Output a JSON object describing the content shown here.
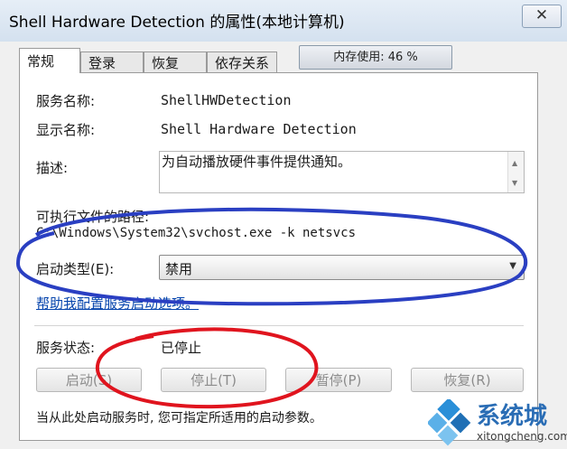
{
  "window": {
    "title": "Shell Hardware Detection 的属性(本地计算机)",
    "close_glyph": "✕"
  },
  "tabs": [
    {
      "label": "常规",
      "active": true
    },
    {
      "label": "登录",
      "active": false
    },
    {
      "label": "恢复",
      "active": false
    },
    {
      "label": "依存关系",
      "active": false
    }
  ],
  "memory": {
    "label": "内存使用: 46 %",
    "value": 46
  },
  "general": {
    "service_name_label": "服务名称:",
    "service_name_value": "ShellHWDetection",
    "display_name_label": "显示名称:",
    "display_name_value": "Shell Hardware Detection",
    "description_label": "描述:",
    "description_value": "为自动播放硬件事件提供通知。",
    "exe_path_label": "可执行文件的路径:",
    "exe_path_value": "C:\\Windows\\System32\\svchost.exe -k netsvcs",
    "startup_type_label": "启动类型(E):",
    "startup_type_value": "禁用",
    "help_link": "帮助我配置服务启动选项。",
    "status_label": "服务状态:",
    "status_value": "已停止",
    "buttons": {
      "start": "启动(S)",
      "stop": "停止(T)",
      "pause": "暂停(P)",
      "resume": "恢复(R)"
    },
    "hint_text": "当从此处启动服务时, 您可指定所适用的启动参数。"
  },
  "annotations": {
    "blue_color": "#2a3fc2",
    "red_color": "#e0141e"
  },
  "watermark": {
    "brand_cn": "系统城",
    "url": "xitongcheng.com",
    "brand_color": "#2a6db5"
  }
}
